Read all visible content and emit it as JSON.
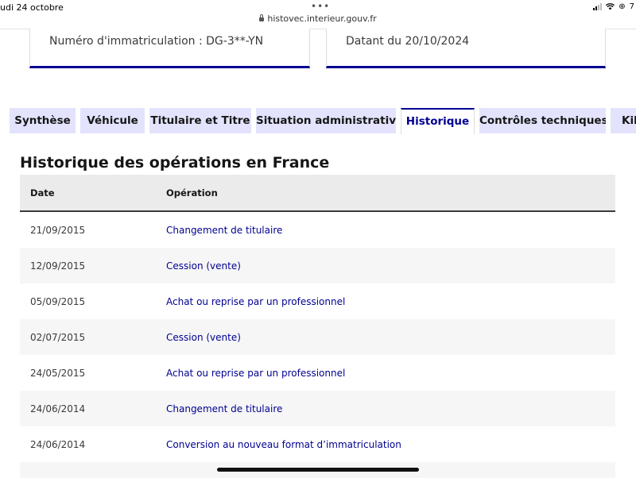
{
  "status_bar": {
    "time_date": "udi 24 octobre",
    "url": "histovec.interieur.gouv.fr",
    "right_label": "7"
  },
  "cards": [
    {
      "text": "Numéro d'immatriculation : DG-3**-YN"
    },
    {
      "text": "Datant du 20/10/2024"
    }
  ],
  "tabs": [
    {
      "label": "Synthèse"
    },
    {
      "label": "Véhicule"
    },
    {
      "label": "Titulaire et Titre"
    },
    {
      "label": "Situation administrative"
    },
    {
      "label": "Historique",
      "active": true
    },
    {
      "label": "Contrôles techniques"
    },
    {
      "label": "Kilo"
    }
  ],
  "section": {
    "title": "Historique des opérations en France"
  },
  "table": {
    "headers": {
      "date": "Date",
      "operation": "Opération"
    },
    "rows": [
      {
        "date": "21/09/2015",
        "operation": "Changement de titulaire"
      },
      {
        "date": "12/09/2015",
        "operation": "Cession (vente)"
      },
      {
        "date": "05/09/2015",
        "operation": "Achat ou reprise par un professionnel"
      },
      {
        "date": "02/07/2015",
        "operation": "Cession (vente)"
      },
      {
        "date": "24/05/2015",
        "operation": "Achat ou reprise par un professionnel"
      },
      {
        "date": "24/06/2014",
        "operation": "Changement de titulaire"
      },
      {
        "date": "24/06/2014",
        "operation": "Conversion au nouveau format d’immatriculation"
      }
    ]
  },
  "colors": {
    "accent": "#000091",
    "tab_bg": "#e3e3fd",
    "header_bg": "#ebebeb",
    "row_alt": "#f6f6f6"
  }
}
